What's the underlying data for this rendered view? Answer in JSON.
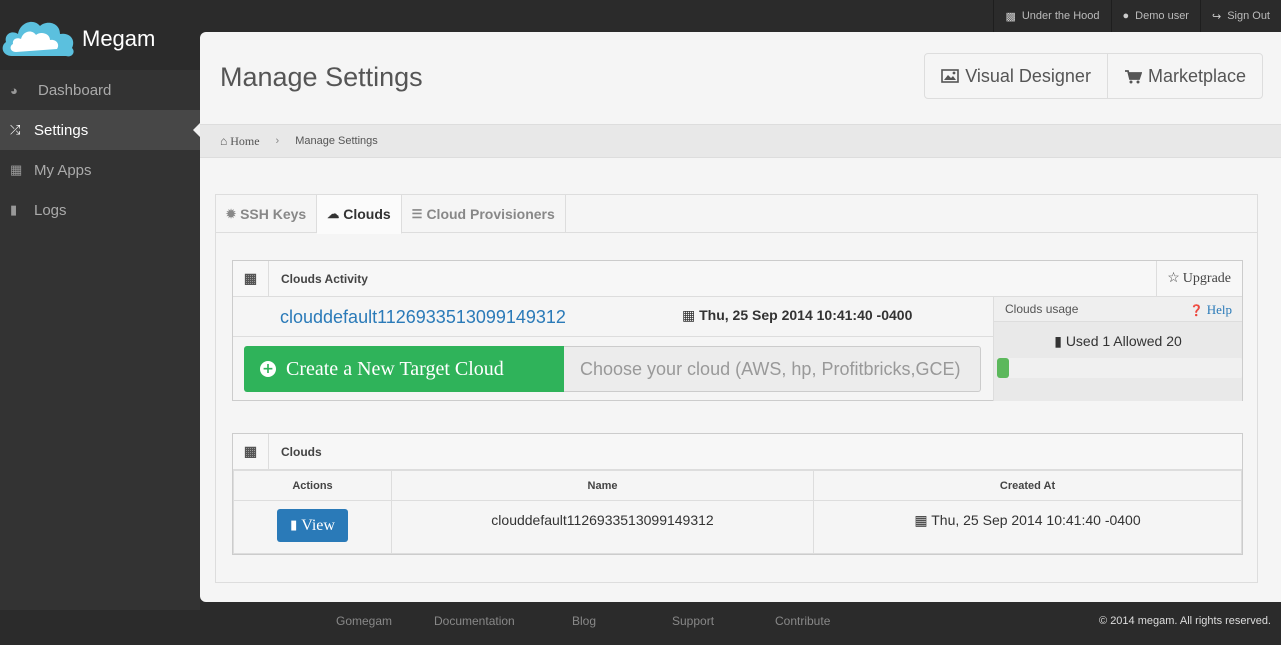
{
  "app": {
    "name": "Megam"
  },
  "topnav": {
    "items": [
      {
        "label": "Under the Hood",
        "icon": "puzzle-icon"
      },
      {
        "label": "Demo user",
        "icon": "user-icon"
      },
      {
        "label": "Sign Out",
        "icon": "sign-out-icon"
      }
    ]
  },
  "sidebar": {
    "items": [
      {
        "label": "Dashboard",
        "icon": "dashboard-icon",
        "active": false
      },
      {
        "label": "Settings",
        "icon": "random-icon",
        "active": true
      },
      {
        "label": "My Apps",
        "icon": "grid-icon",
        "active": false
      },
      {
        "label": "Logs",
        "icon": "video-camera-icon",
        "active": false
      }
    ]
  },
  "header": {
    "title": "Manage Settings",
    "buttons": {
      "visual_designer": "Visual Designer",
      "marketplace": "Marketplace"
    }
  },
  "breadcrumb": {
    "home": "Home",
    "current": "Manage Settings"
  },
  "tabs": [
    {
      "label": "SSH Keys",
      "active": false
    },
    {
      "label": "Clouds",
      "active": true
    },
    {
      "label": "Cloud Provisioners",
      "active": false
    }
  ],
  "activity": {
    "title": "Clouds Activity",
    "upgrade_label": "Upgrade",
    "cloud_name": "clouddefault1126933513099149312",
    "cloud_date": "Thu, 25 Sep 2014 10:41:40 -0400",
    "create_label": "Create a New Target Cloud",
    "input_placeholder": "Choose your cloud (AWS, hp, Profitbricks,GCE)",
    "input_value": ""
  },
  "usage": {
    "title": "Clouds usage",
    "help_label": "Help",
    "text": "Used 1 Allowed 20",
    "used": 1,
    "allowed": 20,
    "fill_fraction": 0.05
  },
  "clouds_table": {
    "title": "Clouds",
    "columns": [
      "Actions",
      "Name",
      "Created At"
    ],
    "rows": [
      {
        "action_label": "View",
        "name": "clouddefault1126933513099149312",
        "created_at": "Thu, 25 Sep 2014 10:41:40 -0400"
      }
    ]
  },
  "footer": {
    "links": [
      "Gomegam",
      "Documentation",
      "Blog",
      "Support",
      "Contribute"
    ],
    "copyright": "© 2014 megam. All rights reserved."
  },
  "colors": {
    "accent_blue": "#2a7ab8",
    "success_green": "#2fb35a",
    "sidebar_bg": "#333333",
    "logo_cloud": "#5bc0de"
  }
}
